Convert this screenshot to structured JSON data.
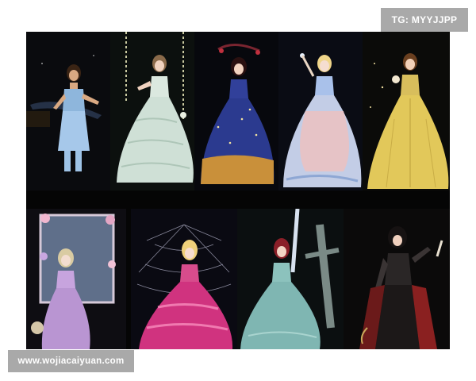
{
  "watermarks": {
    "top_right": "TG: MYYJJPP",
    "bottom_left": "www.wojiacaiyuan.com"
  },
  "tiles": {
    "top": [
      {
        "name": "blue-bodice-outfit",
        "dress_color": "#9ec3e6"
      },
      {
        "name": "mint-ruffled-ballgown",
        "dress_color": "#cfe0d6"
      },
      {
        "name": "navy-starry-ballgown",
        "dress_color": "#2b3a8f"
      },
      {
        "name": "pink-blue-layered-ballgown",
        "dress_color": "#e6c3c6"
      },
      {
        "name": "golden-yellow-gown",
        "dress_color": "#e2c85a"
      }
    ],
    "bottom": [
      {
        "name": "lavender-dress-floral-frame",
        "dress_color": "#b995d2"
      },
      {
        "name": "magenta-ruffled-gown-web",
        "dress_color": "#d0337f"
      },
      {
        "name": "teal-gown-with-sword",
        "dress_color": "#7fb6b2"
      },
      {
        "name": "black-red-armored-outfit",
        "dress_color": "#6b1a1a"
      }
    ]
  }
}
